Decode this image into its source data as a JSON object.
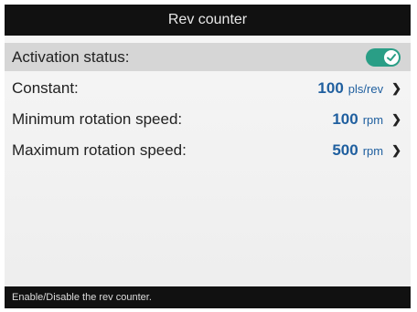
{
  "header": {
    "title": "Rev counter"
  },
  "settings": {
    "activation": {
      "label": "Activation status:",
      "enabled": true,
      "toggle_color": "#2a9e86"
    },
    "constant": {
      "label": "Constant:",
      "value": "100",
      "unit": "pls/rev"
    },
    "min_speed": {
      "label": "Minimum rotation speed:",
      "value": "100",
      "unit": "rpm"
    },
    "max_speed": {
      "label": "Maximum rotation speed:",
      "value": "500",
      "unit": "rpm"
    }
  },
  "footer": {
    "help_text": "Enable/Disable the rev counter."
  },
  "colors": {
    "value_accent": "#1f5f9f",
    "bar_background": "#111111",
    "selected_row": "#d6d6d6"
  },
  "icons": {
    "chevron": "chevron-right-icon",
    "check": "check-icon"
  }
}
